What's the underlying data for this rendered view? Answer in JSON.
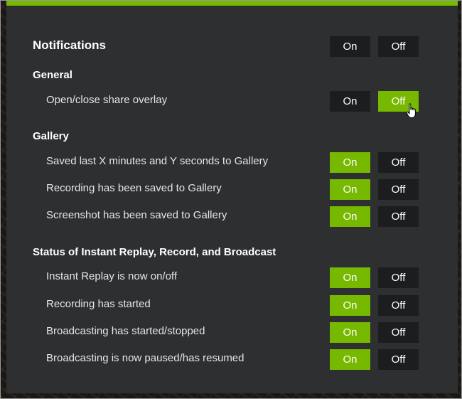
{
  "colors": {
    "accent": "#76b900",
    "panel": "#2d2f30",
    "button": "#1c1d1e"
  },
  "master": {
    "label": "Notifications",
    "on": "On",
    "off": "Off",
    "selected": "none"
  },
  "sections": [
    {
      "title": "General",
      "items": [
        {
          "label": "Open/close share overlay",
          "on": "On",
          "off": "Off",
          "selected": "off"
        }
      ]
    },
    {
      "title": "Gallery",
      "items": [
        {
          "label": "Saved last X minutes and Y seconds to Gallery",
          "on": "On",
          "off": "Off",
          "selected": "on"
        },
        {
          "label": "Recording has been saved to Gallery",
          "on": "On",
          "off": "Off",
          "selected": "on"
        },
        {
          "label": "Screenshot has been saved to Gallery",
          "on": "On",
          "off": "Off",
          "selected": "on"
        }
      ]
    },
    {
      "title": "Status of Instant Replay, Record, and Broadcast",
      "items": [
        {
          "label": "Instant Replay is now on/off",
          "on": "On",
          "off": "Off",
          "selected": "on"
        },
        {
          "label": "Recording has started",
          "on": "On",
          "off": "Off",
          "selected": "on"
        },
        {
          "label": "Broadcasting has started/stopped",
          "on": "On",
          "off": "Off",
          "selected": "on"
        },
        {
          "label": "Broadcasting is now paused/has resumed",
          "on": "On",
          "off": "Off",
          "selected": "on"
        }
      ]
    }
  ],
  "cursor_icon": "hand-pointer-icon"
}
